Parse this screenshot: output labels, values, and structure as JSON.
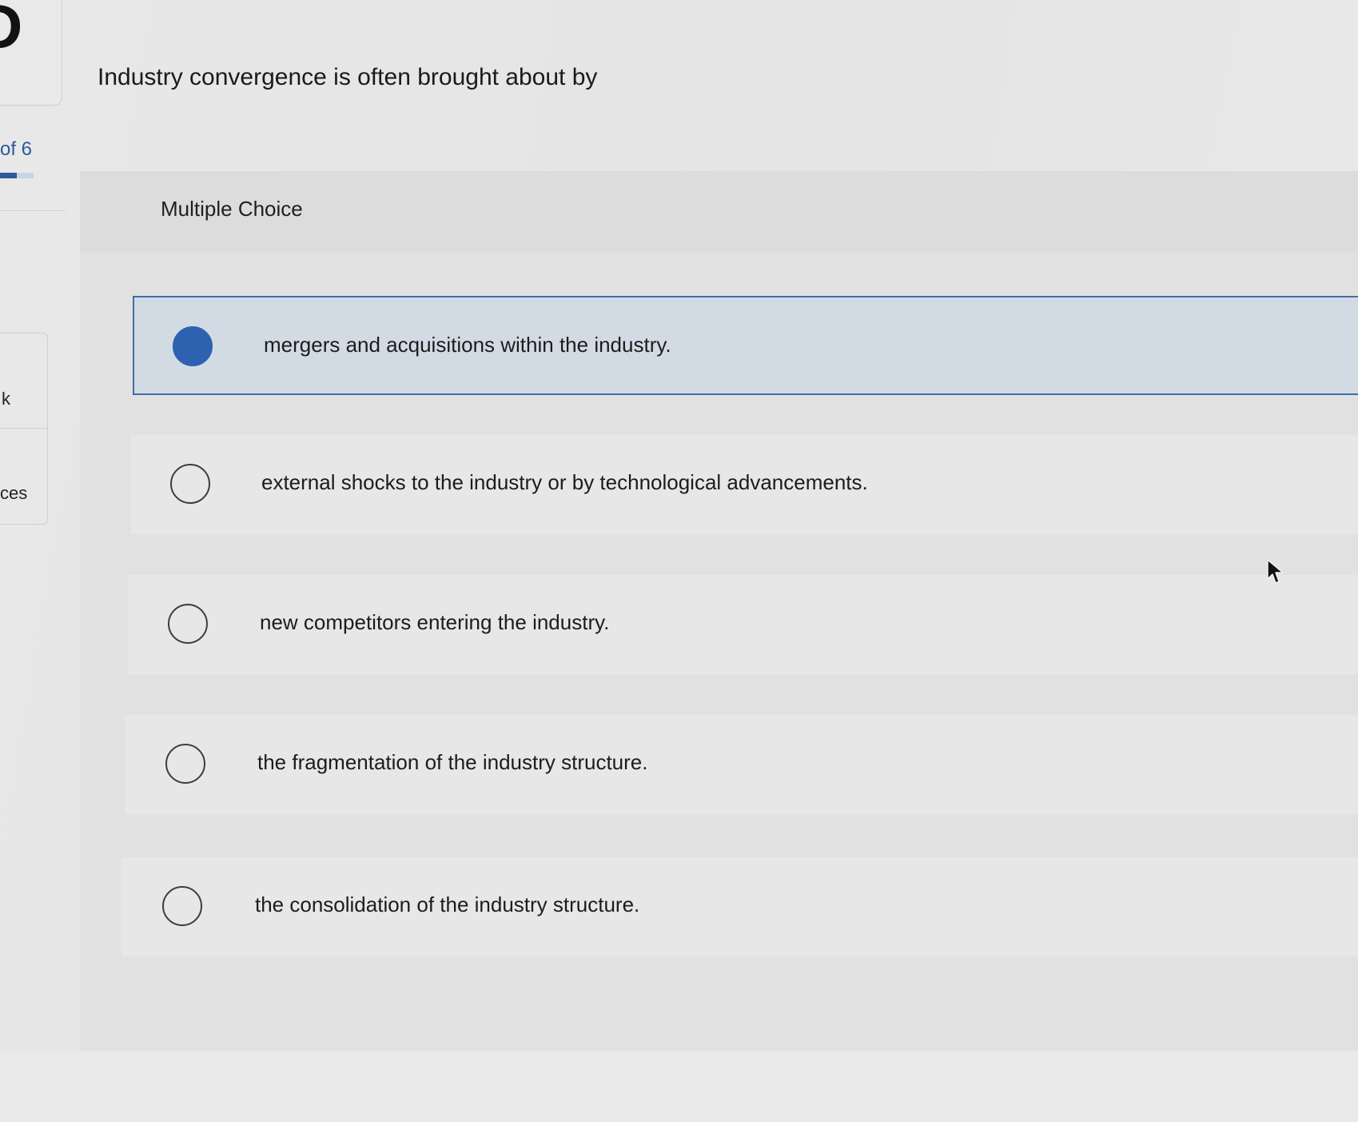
{
  "sidebar": {
    "logo_glyph": "D",
    "progress_text": "of 6",
    "progress_fraction": 0.5,
    "link_1": "k",
    "link_2": "ces"
  },
  "question": {
    "text": "Industry convergence is often brought about by"
  },
  "panel": {
    "title": "Multiple Choice"
  },
  "choices": [
    {
      "label": "mergers and acquisitions within the industry.",
      "selected": true
    },
    {
      "label": "external shocks to the industry or by technological advancements.",
      "selected": false
    },
    {
      "label": "new competitors entering the industry.",
      "selected": false
    },
    {
      "label": "the fragmentation of the industry structure.",
      "selected": false
    },
    {
      "label": "the consolidation of the industry structure.",
      "selected": false
    }
  ],
  "colors": {
    "accent": "#2d62b0",
    "selected_bg": "#d2dbe4",
    "selected_border": "#3e6da9",
    "progress": "#2c5a9c"
  },
  "icons": {
    "cursor": "mouse-pointer-icon",
    "selected_radio": "radio-filled-icon",
    "unselected_radio": "radio-empty-icon"
  }
}
